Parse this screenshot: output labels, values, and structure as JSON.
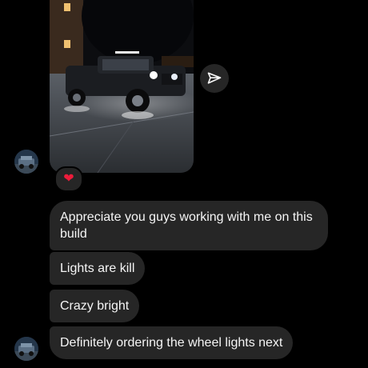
{
  "thread": {
    "photo": {
      "description": ""
    },
    "reaction": {
      "emoji": "❤"
    },
    "messages": [
      {
        "text": "Appreciate you guys working with me on this build"
      },
      {
        "text": "Lights are kill"
      },
      {
        "text": "Crazy bright"
      },
      {
        "text": "Definitely ordering the wheel lights next"
      }
    ]
  },
  "icons": {
    "share": "paper-plane-icon",
    "avatar": "truck-avatar"
  },
  "colors": {
    "background": "#000000",
    "bubble": "#262626",
    "text": "#f5f5f5",
    "heart": "#ed1c3b"
  }
}
